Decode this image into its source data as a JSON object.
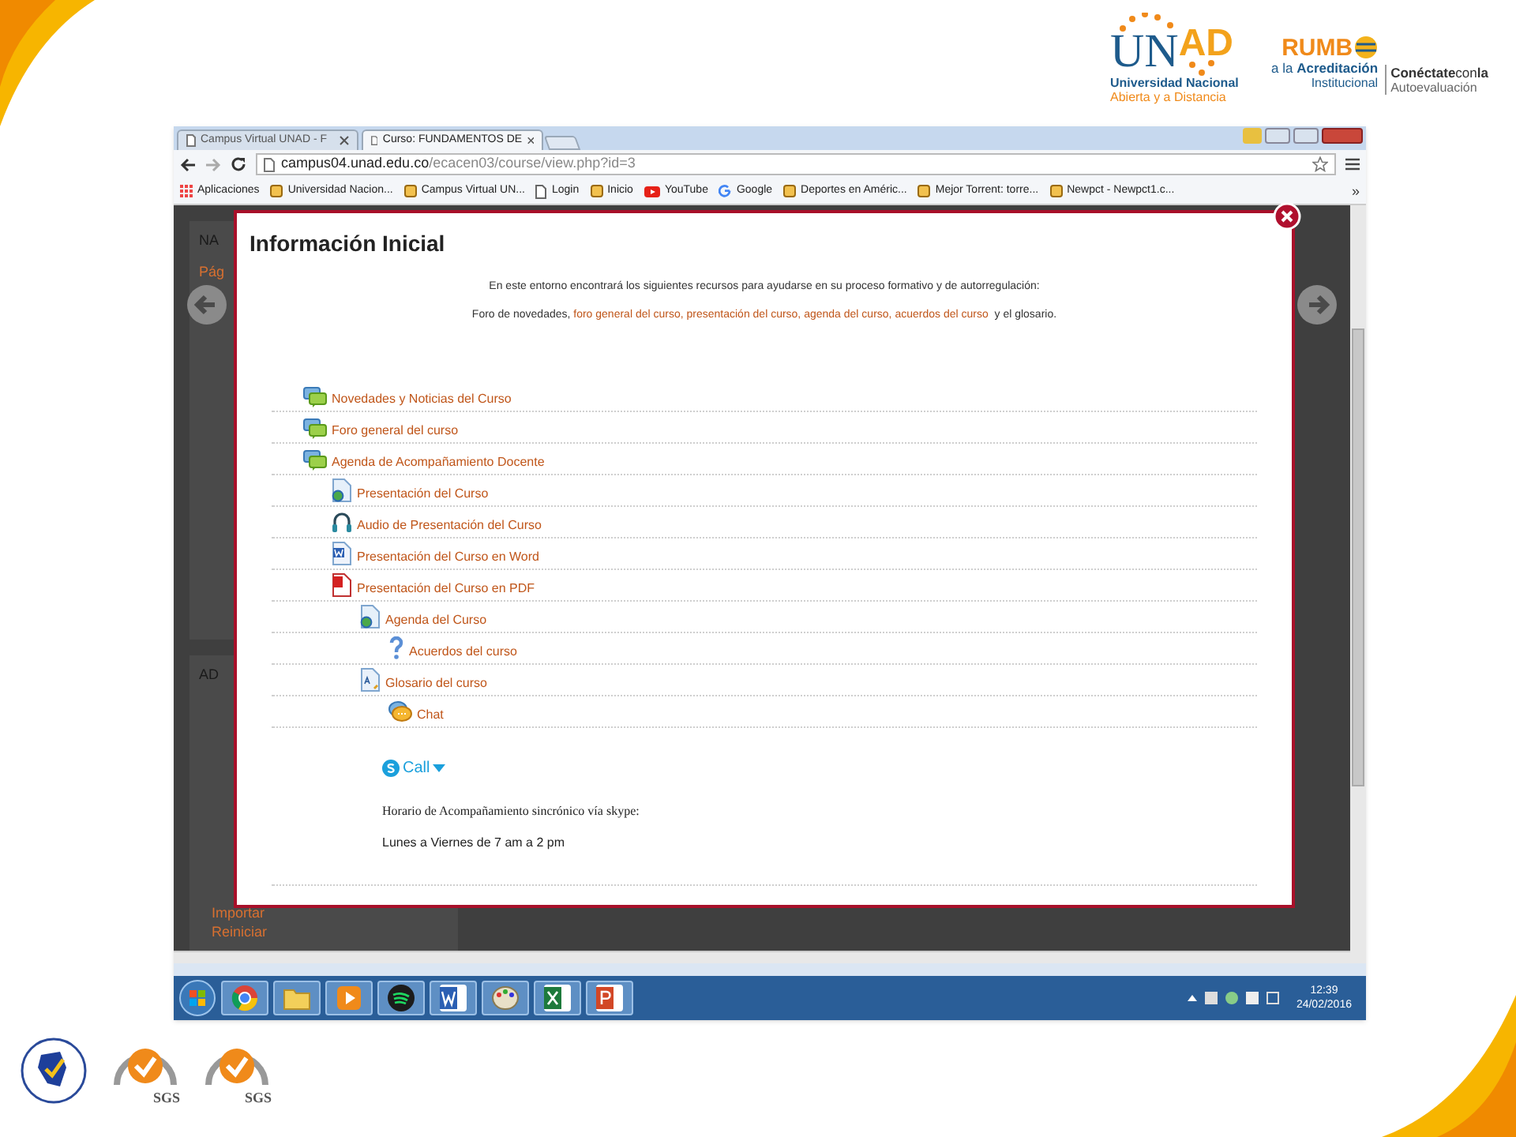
{
  "slide": {
    "unad_logo": {
      "wordmark_left": "UN",
      "wordmark_right": "AD",
      "line_1": "Universidad Nacional",
      "line_2": "Abierta y a Distancia"
    },
    "rumbo_logo": {
      "wordmark": "RUMB",
      "line_1": "a la **Acreditación**",
      "line_2": "Institucional"
    },
    "campaign_logo": {
      "line_1": "**Conéctate**con**la**",
      "line_2": "Autoevaluación"
    },
    "seals": [
      {
        "kind": "map"
      },
      {
        "kind": "sgs",
        "label": "SGS"
      },
      {
        "kind": "sgs",
        "label": "SGS"
      }
    ]
  },
  "browser": {
    "tabs": [
      {
        "label": "Campus Virtual UNAD - F",
        "selected": false
      },
      {
        "label": "Curso: FUNDAMENTOS DE",
        "selected": true
      }
    ],
    "address": {
      "host": "campus04.unad.edu.co",
      "path": "/ecacen03/course/view.php?id=3"
    },
    "bookmarks": [
      {
        "label": "Aplicaciones",
        "kind": "apps"
      },
      {
        "label": "Universidad Nacion...",
        "kind": "site"
      },
      {
        "label": "Campus Virtual UN...",
        "kind": "site"
      },
      {
        "label": "Login",
        "kind": "page"
      },
      {
        "label": "Inicio",
        "kind": "site"
      },
      {
        "label": "YouTube",
        "kind": "video"
      },
      {
        "label": "Google",
        "kind": "search"
      },
      {
        "label": "Deportes en Améric...",
        "kind": "site"
      },
      {
        "label": "Mejor Torrent: torre...",
        "kind": "site"
      },
      {
        "label": "Newpct - Newpct1.c...",
        "kind": "site"
      }
    ],
    "bookmarks_more": "»",
    "page_background": {
      "block_1_title": "NA",
      "block_1_item": "Pág",
      "block_2_title": "AD",
      "links": [
        "Importar",
        "Reiniciar"
      ]
    }
  },
  "modal": {
    "title": "Información Inicial",
    "intro": "En este entorno encontrará los siguientes recursos para ayudarse en su proceso formativo y de autorregulación:",
    "resources_line": [
      {
        "kind": "text",
        "text": "Foro de novedades, "
      },
      {
        "kind": "link",
        "text": "foro general del curso,"
      },
      {
        "kind": "link",
        "text": "presentación del curso,"
      },
      {
        "kind": "link",
        "text": "agenda del curso,"
      },
      {
        "kind": "link",
        "text": "acuerdos del curso"
      },
      {
        "kind": "text",
        "text": " y el glosario."
      }
    ],
    "resources": [
      {
        "label": "Novedades y Noticias del Curso",
        "kind": "forum"
      },
      {
        "label": "Foro general del curso",
        "kind": "forum"
      },
      {
        "label": "Agenda de Acompañamiento Docente",
        "kind": "forum",
        "children": [
          {
            "label": "Presentación del Curso",
            "kind": "page"
          },
          {
            "label": "Audio de Presentación del Curso",
            "kind": "audio"
          },
          {
            "label": "Presentación del Curso en Word",
            "kind": "word"
          },
          {
            "label": "Presentación del Curso en PDF",
            "kind": "pdf",
            "children": [
              {
                "label": "Agenda del Curso",
                "kind": "page",
                "children": [
                  {
                    "label": "Acuerdos del curso",
                    "kind": "question"
                  }
                ]
              },
              {
                "label": "Glosario del curso",
                "kind": "glossary",
                "children": [
                  {
                    "label": "Chat",
                    "kind": "chat"
                  }
                ]
              }
            ]
          }
        ]
      }
    ],
    "call_button": "Call",
    "schedule_heading": "Horario de Acompañamiento sincrónico vía skype:",
    "schedule": "Lunes a Viernes de 7 am a 2 pm"
  },
  "taskbar": {
    "apps": [
      {
        "kind": "browser"
      },
      {
        "kind": "folder"
      },
      {
        "kind": "media"
      },
      {
        "kind": "music"
      },
      {
        "kind": "word"
      },
      {
        "kind": "paint"
      },
      {
        "kind": "excel"
      },
      {
        "kind": "powerpoint"
      }
    ],
    "time": "12:39",
    "date": "24/02/2016"
  }
}
